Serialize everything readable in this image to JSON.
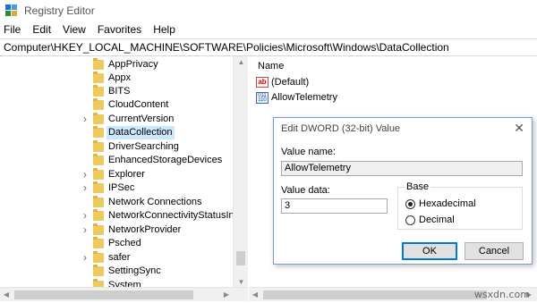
{
  "window": {
    "title": "Registry Editor",
    "icon_colors": [
      "#1f6fd1",
      "#3aa0e8",
      "#2b8a3e",
      "#e0a82e"
    ]
  },
  "menu": [
    "File",
    "Edit",
    "View",
    "Favorites",
    "Help"
  ],
  "address": "Computer\\HKEY_LOCAL_MACHINE\\SOFTWARE\\Policies\\Microsoft\\Windows\\DataCollection",
  "tree": {
    "items": [
      {
        "label": "AppPrivacy",
        "expandable": false,
        "selected": false
      },
      {
        "label": "Appx",
        "expandable": false,
        "selected": false
      },
      {
        "label": "BITS",
        "expandable": false,
        "selected": false
      },
      {
        "label": "CloudContent",
        "expandable": false,
        "selected": false
      },
      {
        "label": "CurrentVersion",
        "expandable": true,
        "selected": false
      },
      {
        "label": "DataCollection",
        "expandable": false,
        "selected": true
      },
      {
        "label": "DriverSearching",
        "expandable": false,
        "selected": false
      },
      {
        "label": "EnhancedStorageDevices",
        "expandable": false,
        "selected": false
      },
      {
        "label": "Explorer",
        "expandable": true,
        "selected": false
      },
      {
        "label": "IPSec",
        "expandable": true,
        "selected": false
      },
      {
        "label": "Network Connections",
        "expandable": false,
        "selected": false
      },
      {
        "label": "NetworkConnectivityStatusIndi",
        "expandable": true,
        "selected": false
      },
      {
        "label": "NetworkProvider",
        "expandable": true,
        "selected": false
      },
      {
        "label": "Psched",
        "expandable": false,
        "selected": false
      },
      {
        "label": "safer",
        "expandable": true,
        "selected": false
      },
      {
        "label": "SettingSync",
        "expandable": false,
        "selected": false
      },
      {
        "label": "System",
        "expandable": false,
        "selected": false
      }
    ]
  },
  "values_pane": {
    "column_header": "Name",
    "rows": [
      {
        "name": "(Default)",
        "icon": "string-value-icon",
        "icon_text": "ab"
      },
      {
        "name": "AllowTelemetry",
        "icon": "dword-value-icon",
        "icon_text": "011\n110"
      }
    ]
  },
  "dialog": {
    "title": "Edit DWORD (32-bit) Value",
    "close_glyph": "✕",
    "value_name_label": "Value name:",
    "value_name": "AllowTelemetry",
    "value_data_label": "Value data:",
    "value_data": "3",
    "base_label": "Base",
    "base_options": [
      {
        "label": "Hexadecimal",
        "selected": true
      },
      {
        "label": "Decimal",
        "selected": false
      }
    ],
    "ok_label": "OK",
    "cancel_label": "Cancel"
  },
  "watermark": "wsxdn.com"
}
